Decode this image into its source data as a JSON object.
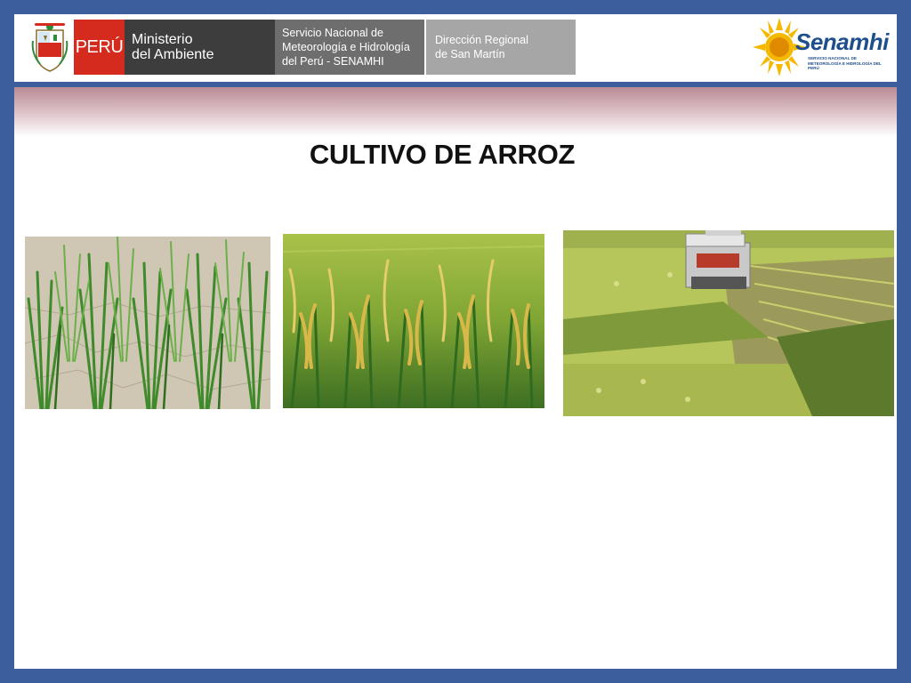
{
  "header": {
    "peru_label": "PERÚ",
    "ministry_line1": "Ministerio",
    "ministry_line2": "del Ambiente",
    "senamhi_line1": "Servicio Nacional de",
    "senamhi_line2": "Meteorología e Hidrología",
    "senamhi_line3": "del Perú - SENAMHI",
    "direction_line1": "Dirección Regional",
    "direction_line2": "de San Martín",
    "logo_name": "Senamhi",
    "logo_subtitle": "SERVICIO NACIONAL DE METEOROLOGÍA E HIDROLOGÍA DEL PERÚ"
  },
  "slide": {
    "title": "CULTIVO DE ARROZ"
  },
  "photos": [
    {
      "subject": "young rice seedlings in cracked dry soil"
    },
    {
      "subject": "mature rice panicles with golden grains"
    },
    {
      "subject": "combine harvester in a rice field"
    }
  ],
  "colors": {
    "frame": "#3a5f9c",
    "peru_red": "#d52b1e",
    "ministry_gray": "#3d3d3d",
    "senamhi_gray": "#6e6e6e",
    "direction_gray": "#a6a6a6",
    "logo_blue": "#1f4e8c",
    "logo_sun": "#f5b800"
  }
}
